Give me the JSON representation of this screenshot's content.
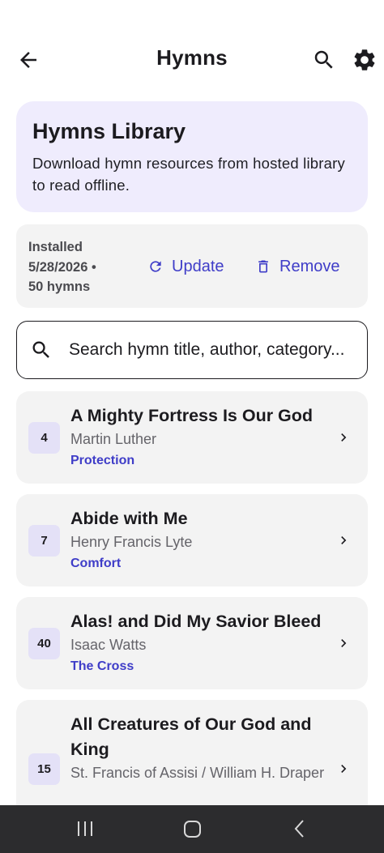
{
  "app_bar": {
    "title": "Hymns",
    "back_icon": "arrow-back-icon",
    "search_icon": "search-icon",
    "settings_icon": "gear-icon"
  },
  "library": {
    "title": "Hymns Library",
    "description": "Download hymn resources from hosted library to read offline."
  },
  "install": {
    "line1": "Installed",
    "line2": "5/28/2026 •",
    "line3": "50 hymns",
    "update_label": "Update",
    "remove_label": "Remove"
  },
  "search": {
    "placeholder": "Search hymn title, author, category..."
  },
  "hymns": [
    {
      "number": "4",
      "title": "A Mighty Fortress Is Our God",
      "author": "Martin Luther",
      "category": "Protection"
    },
    {
      "number": "7",
      "title": "Abide with Me",
      "author": "Henry Francis Lyte",
      "category": "Comfort"
    },
    {
      "number": "40",
      "title": "Alas! and Did My Savior Bleed",
      "author": "Isaac Watts",
      "category": "The Cross"
    },
    {
      "number": "15",
      "title": "All Creatures of Our God and King",
      "author": "St. Francis of Assisi / William H. Draper",
      "category": ""
    }
  ],
  "colors": {
    "accent": "#3f3dc8",
    "library_card_bg": "#efecfd",
    "card_bg": "#f3f3f3",
    "number_badge_bg": "#e4e1f7",
    "navbar_bg": "#2c2c2e"
  }
}
